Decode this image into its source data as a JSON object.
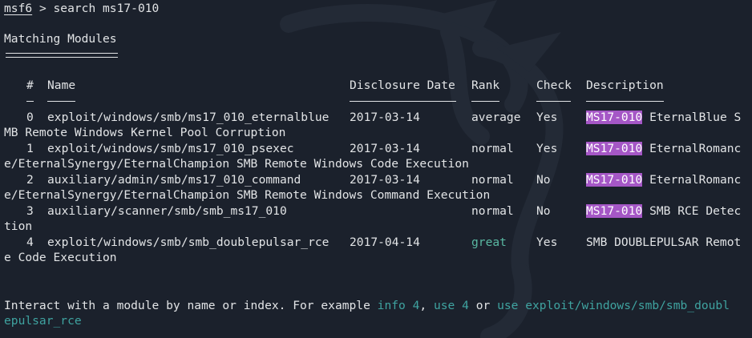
{
  "prompt": {
    "app": "msf6",
    "symbol": " > ",
    "command": "search ms17-010"
  },
  "section_title": "Matching Modules",
  "columns": {
    "num": "#",
    "name": "Name",
    "date": "Disclosure Date",
    "rank": "Rank",
    "check": "Check",
    "desc": "Description"
  },
  "rows": [
    {
      "num": "0",
      "name": "exploit/windows/smb/ms17_010_eternalblue",
      "date": "2017-03-14",
      "rank": "average",
      "check": "Yes",
      "highlight": "MS17-010",
      "desc_rest": " EternalBlue S",
      "wrap": "MB Remote Windows Kernel Pool Corruption"
    },
    {
      "num": "1",
      "name": "exploit/windows/smb/ms17_010_psexec",
      "date": "2017-03-14",
      "rank": "normal",
      "check": "Yes",
      "highlight": "MS17-010",
      "desc_rest": " EternalRomanc",
      "wrap": "e/EternalSynergy/EternalChampion SMB Remote Windows Code Execution"
    },
    {
      "num": "2",
      "name": "auxiliary/admin/smb/ms17_010_command",
      "date": "2017-03-14",
      "rank": "normal",
      "check": "No",
      "highlight": "MS17-010",
      "desc_rest": " EternalRomanc",
      "wrap": "e/EternalSynergy/EternalChampion SMB Remote Windows Command Execution"
    },
    {
      "num": "3",
      "name": "auxiliary/scanner/smb/smb_ms17_010",
      "date": "",
      "rank": "normal",
      "check": "No",
      "highlight": "MS17-010",
      "desc_rest": " SMB RCE Detec",
      "wrap": "tion"
    },
    {
      "num": "4",
      "name": "exploit/windows/smb/smb_doublepulsar_rce",
      "date": "2017-04-14",
      "rank": "great",
      "check": "Yes",
      "highlight": "",
      "desc_rest": "SMB DOUBLEPULSAR Remot",
      "wrap": "e Code Execution"
    }
  ],
  "footer": {
    "text1": "Interact with a module by name or index. For example ",
    "link1": "info 4",
    "sep1": ", ",
    "link2": "use 4",
    "sep2": " or ",
    "link3a": "use exploit/windows/smb/smb_doubl",
    "link3b": "epulsar_rce"
  },
  "colors": {
    "background": "#1b212c",
    "text": "#e2e4e6",
    "highlight": "#a557c6",
    "great_rank": "#59b8a2",
    "footer_link": "#3fa3a0"
  }
}
